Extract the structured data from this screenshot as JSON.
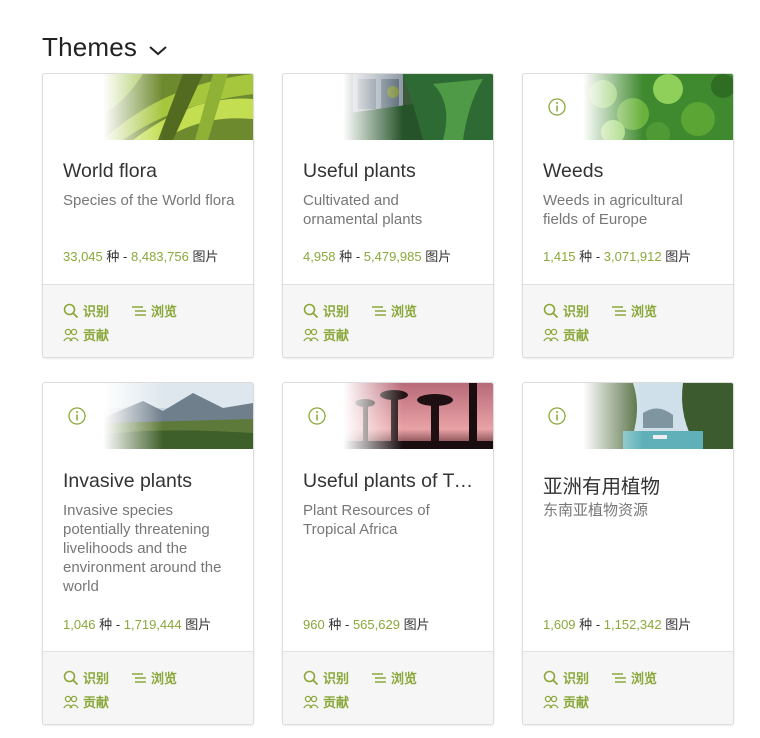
{
  "header": {
    "title": "Themes"
  },
  "cards": [
    {
      "title": "World flora",
      "subtitle": "Species of the World flora",
      "species": "33,045",
      "species_unit": "种",
      "sep": "-",
      "images": "8,483,756",
      "images_unit": "图片",
      "actions": {
        "identify": "识别",
        "browse": "浏览",
        "contribute": "贡献"
      },
      "image": "fern-leaves",
      "has_info": false
    },
    {
      "title": "Useful plants",
      "subtitle": "Cultivated and ornamental plants",
      "species": "4,958",
      "species_unit": "种",
      "sep": "-",
      "images": "5,479,985",
      "images_unit": "图片",
      "actions": {
        "identify": "识别",
        "browse": "浏览",
        "contribute": "贡献"
      },
      "image": "greenhouse",
      "has_info": false
    },
    {
      "title": "Weeds",
      "subtitle": "Weeds in agricultural fields of Europe",
      "species": "1,415",
      "species_unit": "种",
      "sep": "-",
      "images": "3,071,912",
      "images_unit": "图片",
      "actions": {
        "identify": "识别",
        "browse": "浏览",
        "contribute": "贡献"
      },
      "image": "green-crops",
      "has_info": true
    },
    {
      "title": "Invasive plants",
      "subtitle": "Invasive species potentially threatening livelihoods and the environment around the world",
      "species": "1,046",
      "species_unit": "种",
      "sep": "-",
      "images": "1,719,444",
      "images_unit": "图片",
      "actions": {
        "identify": "识别",
        "browse": "浏览",
        "contribute": "贡献"
      },
      "image": "mountain-landscape",
      "has_info": true
    },
    {
      "title": "Useful plants of Tropical Africa",
      "subtitle": "Plant Resources of Tropical Africa",
      "species": "960",
      "species_unit": "种",
      "sep": "-",
      "images": "565,629",
      "images_unit": "图片",
      "actions": {
        "identify": "识别",
        "browse": "浏览",
        "contribute": "贡献"
      },
      "image": "baobab-sunset",
      "has_info": true
    },
    {
      "title": "亚洲有用植物",
      "subtitle": "东南亚植物资源",
      "species": "1,609",
      "species_unit": "种",
      "sep": "-",
      "images": "1,152,342",
      "images_unit": "图片",
      "actions": {
        "identify": "识别",
        "browse": "浏览",
        "contribute": "贡献"
      },
      "image": "tropical-bay",
      "has_info": true
    }
  ],
  "colors": {
    "accent": "#8aa83a",
    "title": "#333333",
    "subtitle": "#777777",
    "footer_bg": "#f6f6f6"
  },
  "icons": [
    "chevron-down-icon",
    "info-icon",
    "search-icon",
    "list-icon",
    "users-icon"
  ]
}
